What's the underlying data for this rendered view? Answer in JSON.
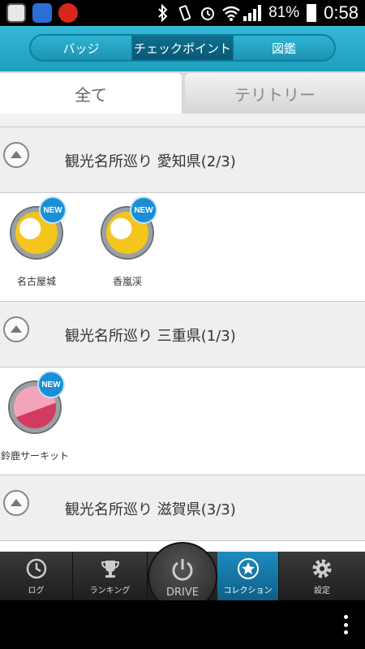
{
  "status": {
    "battery": "81%",
    "time": "0:58"
  },
  "header": {
    "segments": [
      "バッジ",
      "チェックポイント",
      "図鑑"
    ],
    "active_segment": 1
  },
  "tabs": [
    "全て",
    "テリトリー"
  ],
  "sections": [
    {
      "title": "観光名所巡り 愛知県(2/3)",
      "badges": [
        {
          "label": "名古屋城",
          "new": "NEW",
          "style": "yellow"
        },
        {
          "label": "香嵐渓",
          "new": "NEW",
          "style": "yellow"
        }
      ]
    },
    {
      "title": "観光名所巡り 三重県(1/3)",
      "badges": [
        {
          "label": "鈴鹿サーキット",
          "new": "NEW",
          "style": "pink"
        }
      ]
    },
    {
      "title": "観光名所巡り 滋賀県(3/3)",
      "badges": []
    }
  ],
  "nav": {
    "log": "ログ",
    "ranking": "ランキング",
    "drive": "DRIVE",
    "collection": "コレクション",
    "settings": "設定"
  },
  "colors": {
    "accent": "#1f9dbd",
    "active_nav": "#1e8cc0",
    "new_badge": "#1b8fd6"
  },
  "icons": {
    "log": "clock-icon",
    "ranking": "trophy-icon",
    "drive": "power-icon",
    "collection": "star-icon",
    "settings": "gear-icon"
  }
}
